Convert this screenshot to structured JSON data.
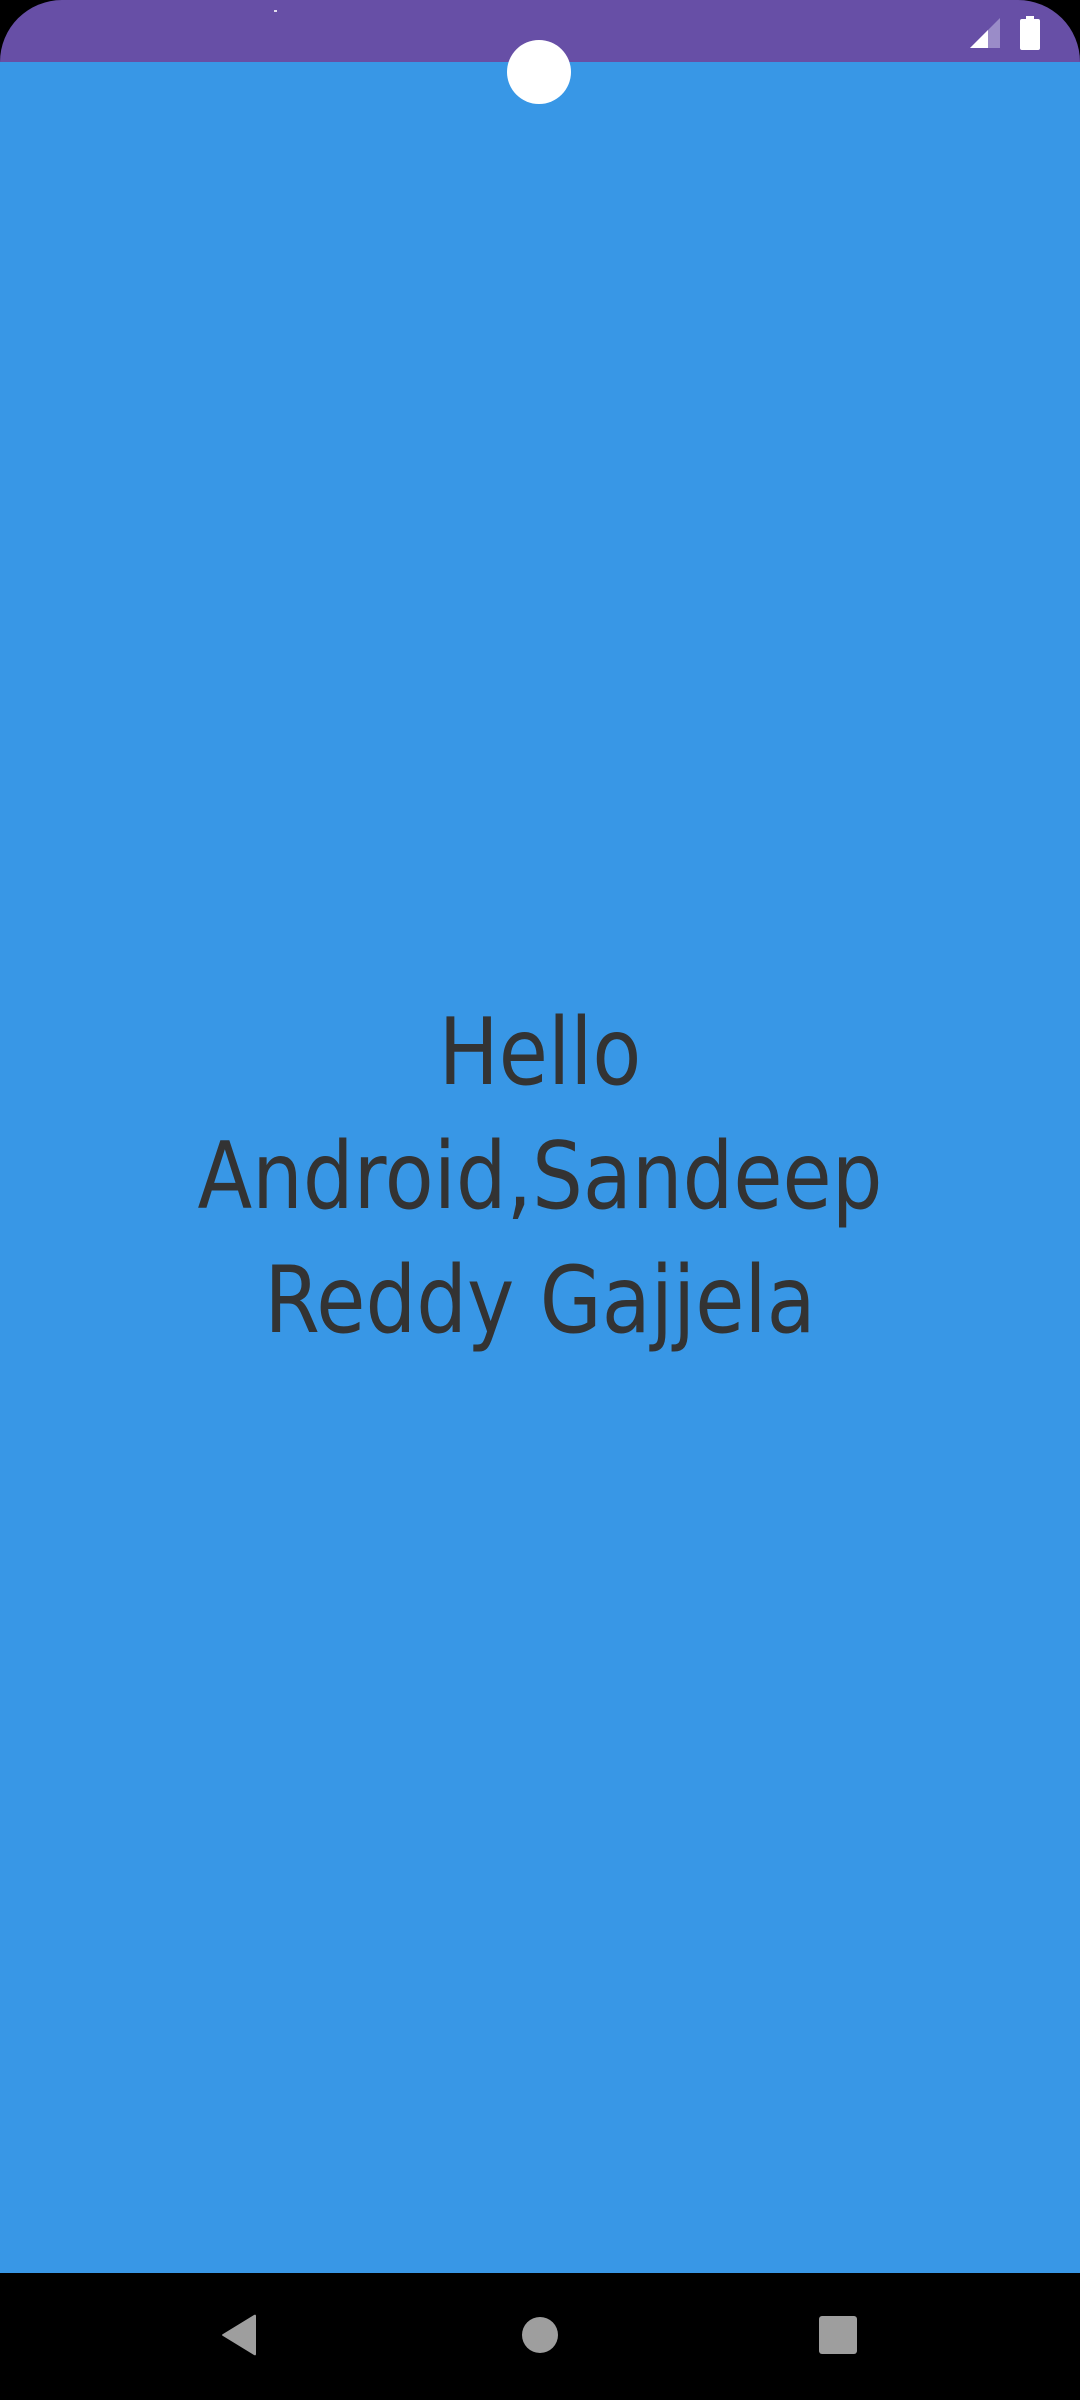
{
  "app": {
    "greeting_text": "Hello Android,Sandeep Reddy Gajjela"
  },
  "status_bar": {
    "icons": [
      "signal-icon",
      "battery-icon"
    ]
  },
  "navigation_bar": {
    "buttons": [
      "back-icon",
      "home-icon",
      "recents-icon"
    ]
  },
  "colors": {
    "status_bar": "#674FA6",
    "content_background": "#3897E6",
    "text": "#333333",
    "nav_bar": "#000000",
    "nav_icons": "#9E9E9E"
  }
}
